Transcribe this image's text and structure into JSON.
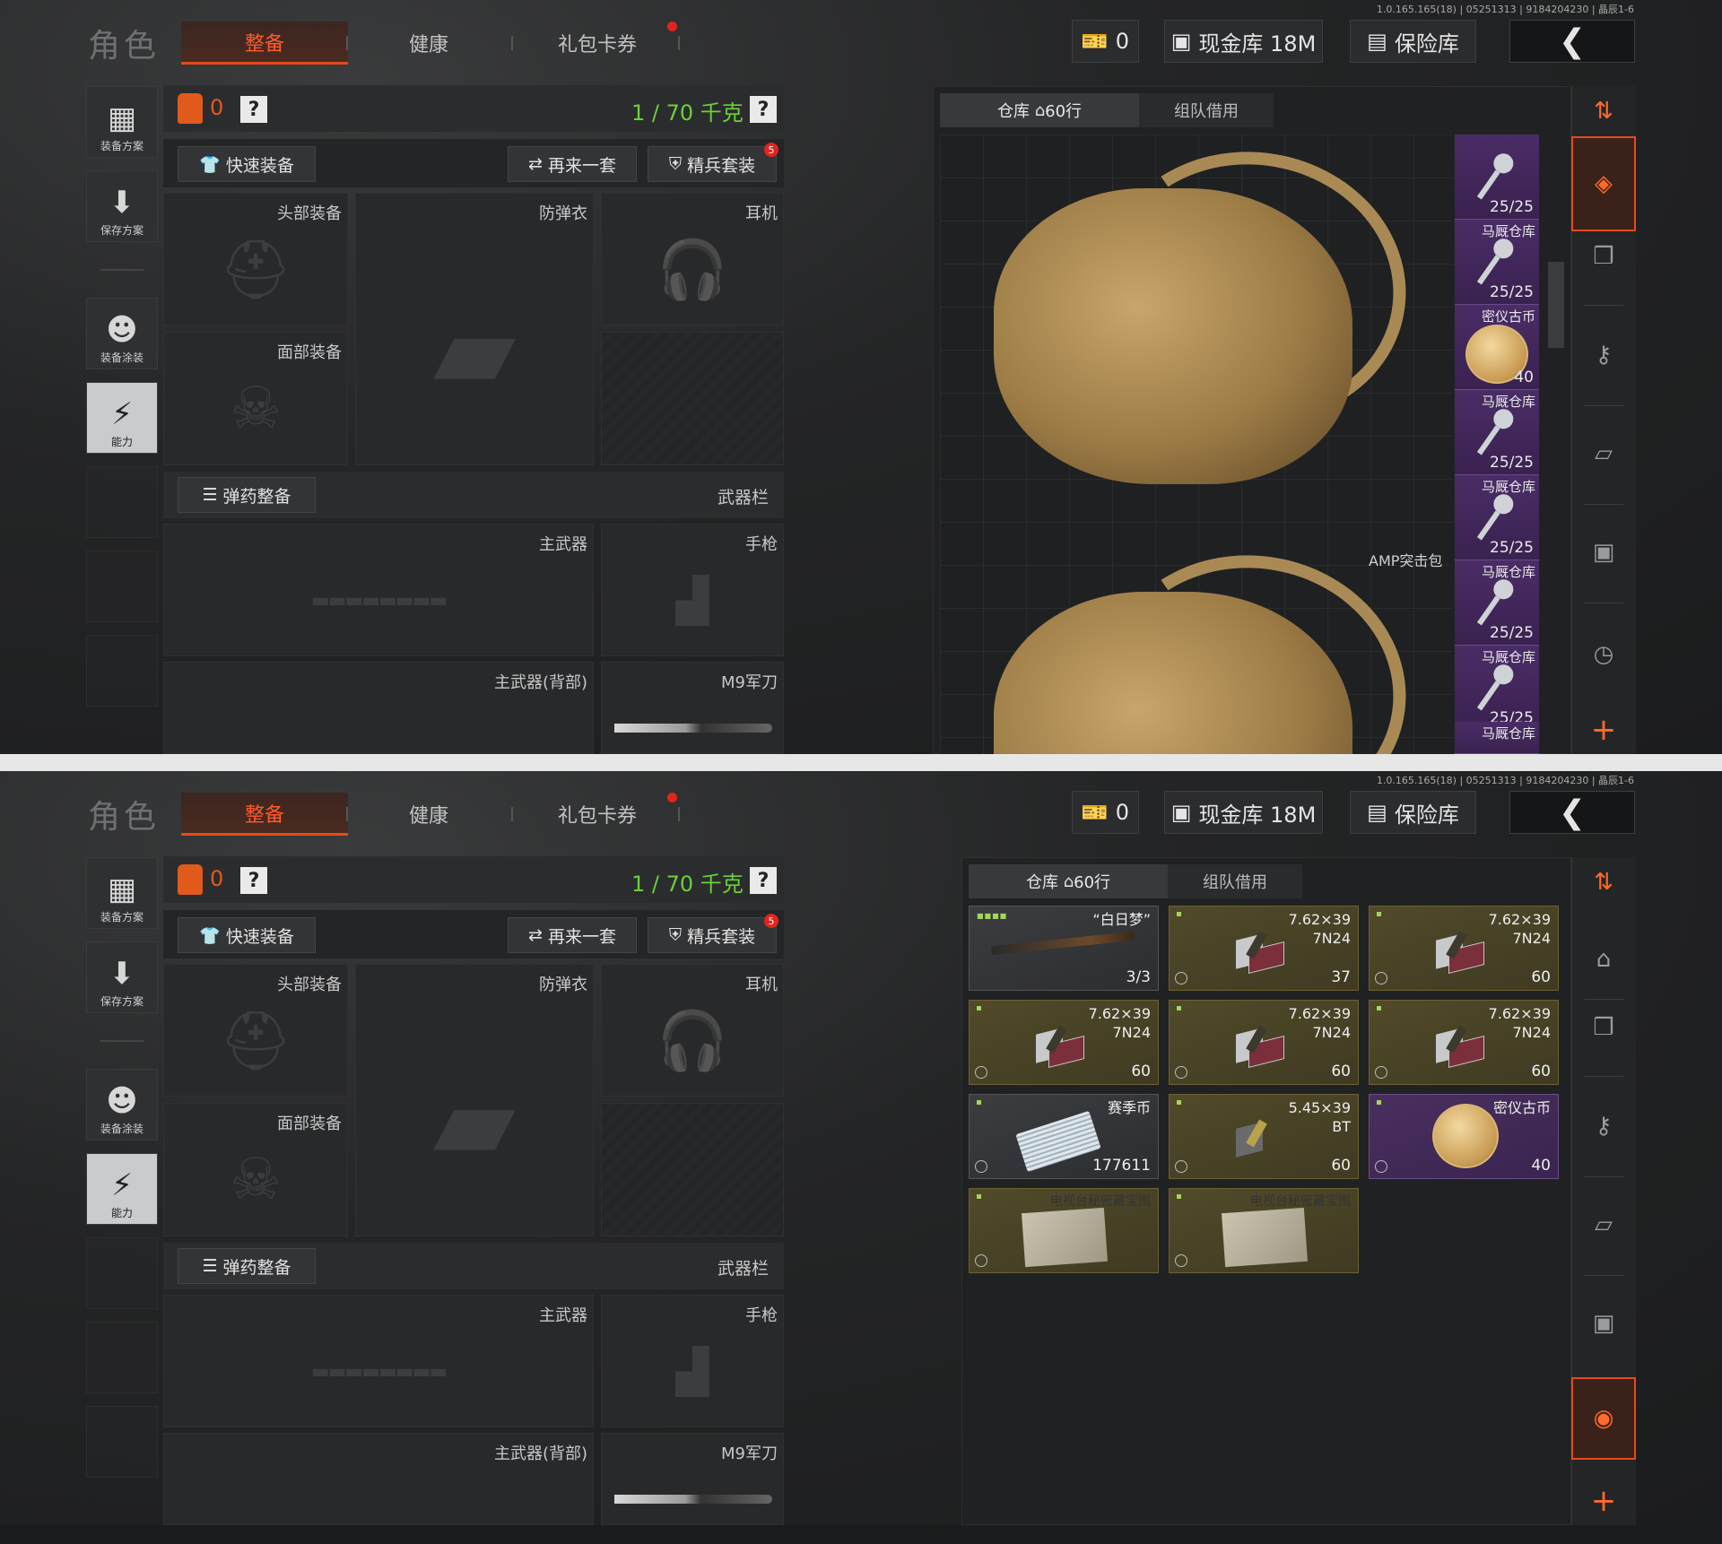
{
  "version_text": "1.0.165.165(18) | 05251313 | 9184204230 | 晶辰1-6",
  "header": {
    "title": "角色",
    "tabs": [
      "整备",
      "健康",
      "礼包卡券"
    ],
    "ticket_count": "0",
    "cash_label": "现金库 18M",
    "safe_label": "保险库"
  },
  "sidebar": {
    "plan": "装备方案",
    "save": "保存方案",
    "paint": "装备涂装",
    "ability": "能力"
  },
  "loadout": {
    "count": "0",
    "weight": "1 / 70 千克",
    "help": "?",
    "quick_equip": "快速装备",
    "again": "再来一套",
    "elite": "精兵套装",
    "elite_badge": "5",
    "slots": {
      "head": "头部装备",
      "armor": "防弹衣",
      "ear": "耳机",
      "face": "面部装备",
      "primary": "主武器",
      "pistol": "手枪",
      "primary_back": "主武器(背部)",
      "knife": "M9军刀"
    },
    "ammo_button": "弹药整备",
    "weapon_bar": "武器栏"
  },
  "storage": {
    "tab_warehouse": "仓库",
    "tab_rows": "60行",
    "tab_team": "组队借用"
  },
  "top_view": {
    "bag_name": "AMP突击包",
    "keys": [
      {
        "name": "",
        "count": "25/25"
      },
      {
        "name": "马厩仓库",
        "count": "25/25"
      },
      {
        "name": "密仪古币",
        "count": "40"
      },
      {
        "name": "马厩仓库",
        "count": "25/25"
      },
      {
        "name": "马厩仓库",
        "count": "25/25"
      },
      {
        "name": "马厩仓库",
        "count": "25/25"
      },
      {
        "name": "马厩仓库",
        "count": "25/25"
      },
      {
        "name": "马厩仓库",
        "count": ""
      }
    ]
  },
  "bottom_items": [
    {
      "name": "“白日梦”",
      "count": "3/3",
      "kind": "shotgun",
      "tone": "gray"
    },
    {
      "name": "7.62×39\n7N24",
      "count": "37",
      "kind": "ammo",
      "tone": "gold"
    },
    {
      "name": "7.62×39\n7N24",
      "count": "60",
      "kind": "ammo",
      "tone": "gold"
    },
    {
      "name": "7.62×39\n7N24",
      "count": "60",
      "kind": "ammo",
      "tone": "gold"
    },
    {
      "name": "7.62×39\n7N24",
      "count": "60",
      "kind": "ammo",
      "tone": "gold"
    },
    {
      "name": "7.62×39\n7N24",
      "count": "60",
      "kind": "ammo",
      "tone": "gold"
    },
    {
      "name": "赛季币",
      "count": "177611",
      "kind": "cash",
      "tone": "gray"
    },
    {
      "name": "5.45×39\nBT",
      "count": "60",
      "kind": "ammo",
      "tone": "gold"
    },
    {
      "name": "密仪古币",
      "count": "40",
      "kind": "coin",
      "tone": "purple"
    },
    {
      "name": "电视台秘密藏宝图",
      "count": "",
      "kind": "map",
      "tone": "gold"
    },
    {
      "name": "电视台秘密藏宝图",
      "count": "",
      "kind": "map",
      "tone": "gold"
    }
  ],
  "colors": {
    "accent": "#e64a19",
    "weight_green": "#6bd03a",
    "badge_red": "#e3241c"
  }
}
